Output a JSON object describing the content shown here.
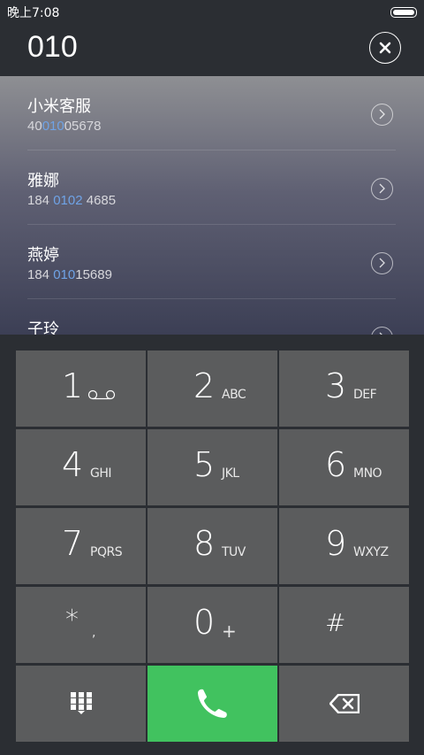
{
  "status_bar": {
    "time": "晚上7:08"
  },
  "header": {
    "number": "010"
  },
  "results": [
    {
      "name": "小米客服",
      "phone_pre": "40",
      "phone_hl": "010",
      "phone_post": "05678"
    },
    {
      "name": "雅娜",
      "phone_pre": "184 ",
      "phone_hl": "0102",
      "phone_post": " 4685"
    },
    {
      "name": "燕婷",
      "phone_pre": "184 ",
      "phone_hl": "010",
      "phone_post": "15689"
    },
    {
      "name": "子玲",
      "phone_pre": "",
      "phone_hl": "",
      "phone_post": ""
    }
  ],
  "keypad": {
    "keys": [
      {
        "digit": "1",
        "letters": ""
      },
      {
        "digit": "2",
        "letters": "ABC"
      },
      {
        "digit": "3",
        "letters": "DEF"
      },
      {
        "digit": "4",
        "letters": "GHI"
      },
      {
        "digit": "5",
        "letters": "JKL"
      },
      {
        "digit": "6",
        "letters": "MNO"
      },
      {
        "digit": "7",
        "letters": "PQRS"
      },
      {
        "digit": "8",
        "letters": "TUV"
      },
      {
        "digit": "9",
        "letters": "WXYZ"
      },
      {
        "digit": "*",
        "letters": ","
      },
      {
        "digit": "0",
        "letters": "+"
      },
      {
        "digit": "#",
        "letters": ""
      }
    ],
    "icons": [
      "voicemail-icon",
      "keypad-toggle-icon",
      "phone-call-icon",
      "backspace-icon"
    ]
  },
  "colors": {
    "call": "#41c25f",
    "highlight": "#6fa3e6",
    "key": "#5b5c5d",
    "background": "#2b2e33"
  }
}
